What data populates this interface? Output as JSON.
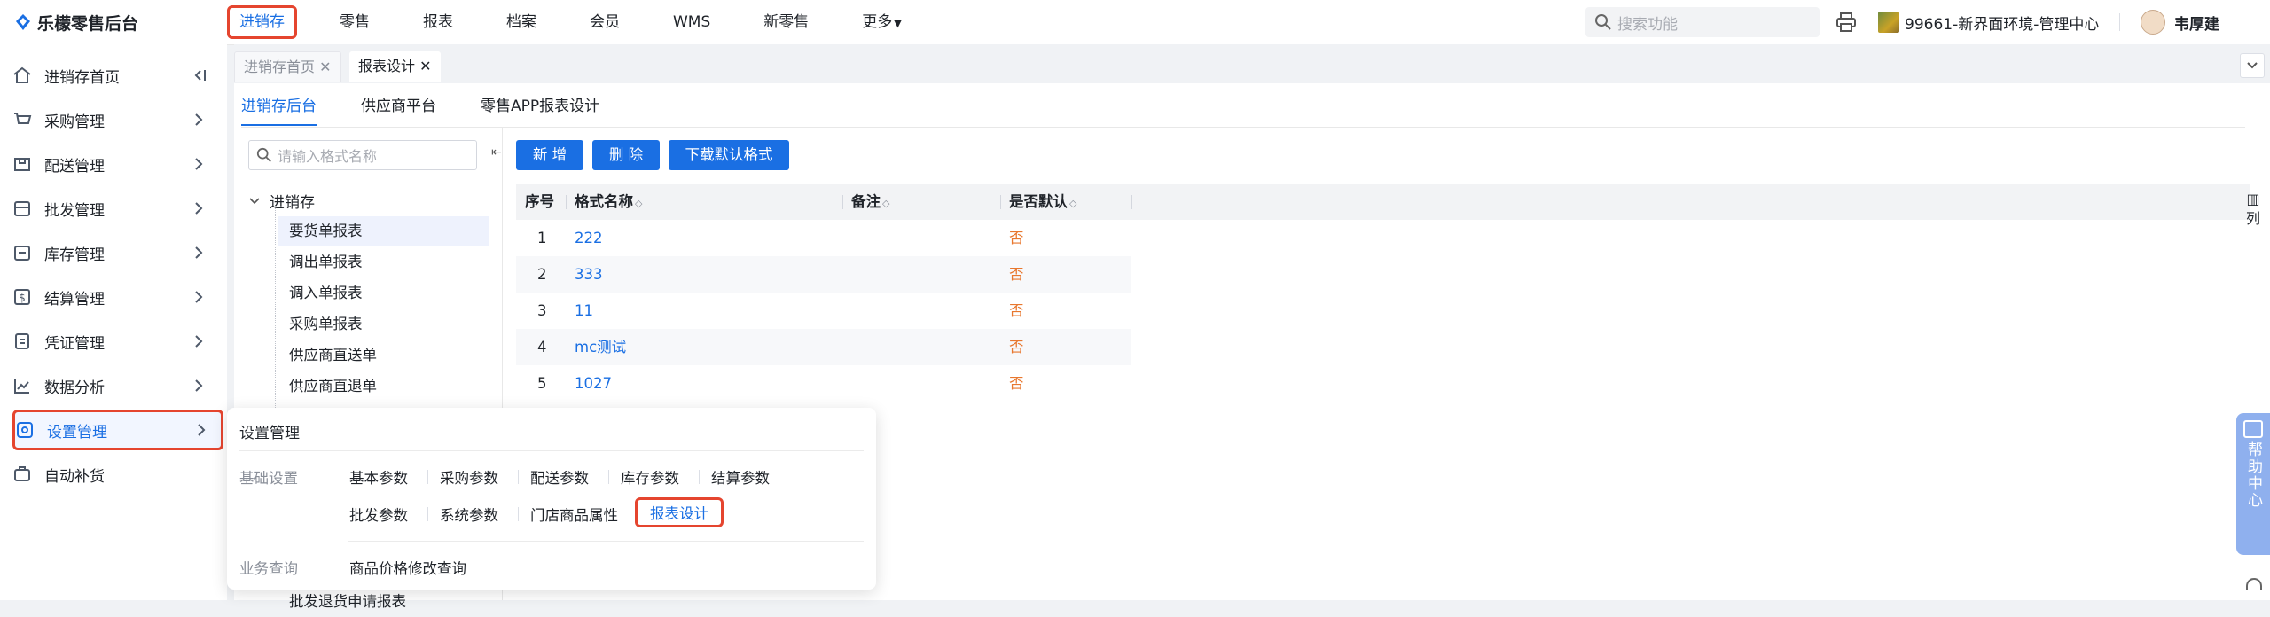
{
  "app": {
    "logo_text": "乐檬零售后台"
  },
  "topnav": {
    "items": [
      "进销存",
      "零售",
      "报表",
      "档案",
      "会员",
      "WMS",
      "新零售",
      "更多"
    ]
  },
  "header": {
    "search_placeholder": "搜索功能",
    "store": "99661-新界面环境-管理中心",
    "user": "韦厚建"
  },
  "sidebar": {
    "items": [
      {
        "label": "进销存首页",
        "icon": "home-icon"
      },
      {
        "label": "采购管理",
        "icon": "cart-icon"
      },
      {
        "label": "配送管理",
        "icon": "delivery-box-icon"
      },
      {
        "label": "批发管理",
        "icon": "wholesale-icon"
      },
      {
        "label": "库存管理",
        "icon": "inventory-icon"
      },
      {
        "label": "结算管理",
        "icon": "settlement-icon"
      },
      {
        "label": "凭证管理",
        "icon": "voucher-icon"
      },
      {
        "label": "数据分析",
        "icon": "chart-line-icon"
      },
      {
        "label": "设置管理",
        "icon": "settings-icon"
      },
      {
        "label": "自动补货",
        "icon": "auto-replenish-icon"
      }
    ]
  },
  "tabs": [
    {
      "label": "进销存首页"
    },
    {
      "label": "报表设计"
    }
  ],
  "subtabs": [
    "进销存后台",
    "供应商平台",
    "零售APP报表设计"
  ],
  "tree": {
    "search_placeholder": "请输入格式名称",
    "root": "进销存",
    "nodes": [
      "要货单报表",
      "调出单报表",
      "调入单报表",
      "采购单报表",
      "供应商直送单",
      "供应商直退单"
    ],
    "partial_node": "批发退货申请报表"
  },
  "actions": {
    "add": "新 增",
    "delete": "删 除",
    "download": "下载默认格式"
  },
  "grid": {
    "columns": [
      "序号",
      "格式名称",
      "备注",
      "是否默认"
    ],
    "rows": [
      {
        "no": "1",
        "name": "222",
        "note": "",
        "default": "否"
      },
      {
        "no": "2",
        "name": "333",
        "note": "",
        "default": "否"
      },
      {
        "no": "3",
        "name": "11",
        "note": "",
        "default": "否"
      },
      {
        "no": "4",
        "name": "mc测试",
        "note": "",
        "default": "否"
      },
      {
        "no": "5",
        "name": "1027",
        "note": "",
        "default": "否"
      }
    ],
    "column_button": "列"
  },
  "popup": {
    "title": "设置管理",
    "groups": [
      {
        "label": "基础设置",
        "links": [
          "基本参数",
          "采购参数",
          "配送参数",
          "库存参数",
          "结算参数",
          "批发参数",
          "系统参数",
          "门店商品属性",
          "报表设计"
        ]
      },
      {
        "label": "业务查询",
        "links": [
          "商品价格修改查询"
        ]
      }
    ]
  },
  "help": {
    "label": "帮助中心"
  },
  "colors": {
    "accent": "#1a6fe3",
    "highlight": "#e5452f",
    "no_value": "#e8772e"
  }
}
